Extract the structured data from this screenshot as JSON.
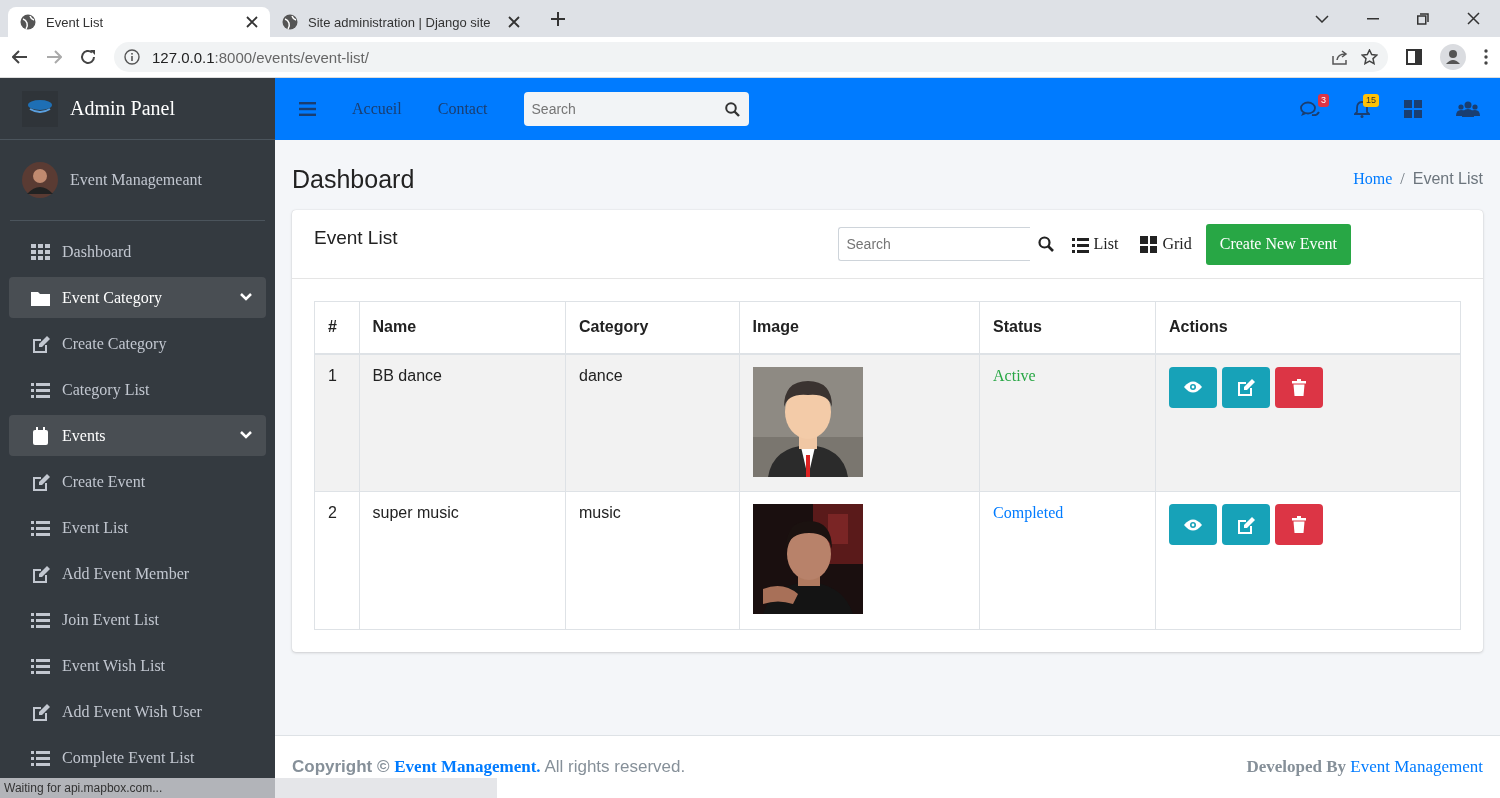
{
  "browser": {
    "tabs": [
      {
        "title": "Event List",
        "selected": true
      },
      {
        "title": "Site administration | Django site",
        "selected": false
      }
    ],
    "address_host": "127.0.0.1",
    "address_path": ":8000/events/event-list/",
    "status_text": "Waiting for api.mapbox.com..."
  },
  "sidebar": {
    "brand": "Admin Panel",
    "user": "Event Managemeant",
    "items": [
      {
        "label": "Dashboard",
        "kind": "link"
      },
      {
        "label": "Event Category",
        "kind": "group",
        "expanded": true
      },
      {
        "label": "Create Category",
        "kind": "link"
      },
      {
        "label": "Category List",
        "kind": "link"
      },
      {
        "label": "Events",
        "kind": "group",
        "expanded": true
      },
      {
        "label": "Create Event",
        "kind": "link"
      },
      {
        "label": "Event List",
        "kind": "link"
      },
      {
        "label": "Add Event Member",
        "kind": "link"
      },
      {
        "label": "Join Event List",
        "kind": "link"
      },
      {
        "label": "Event Wish List",
        "kind": "link"
      },
      {
        "label": "Add Event Wish User",
        "kind": "link"
      },
      {
        "label": "Complete Event List",
        "kind": "link"
      }
    ]
  },
  "navbar": {
    "links": [
      "Accueil",
      "Contact"
    ],
    "search_placeholder": "Search",
    "message_count": "3",
    "notification_count": "15"
  },
  "page": {
    "title": "Dashboard",
    "breadcrumb_separator": "/",
    "breadcrumb": [
      {
        "label": "Home",
        "kind": "link"
      },
      {
        "label": "Event List",
        "kind": "current"
      }
    ]
  },
  "card": {
    "title": "Event List",
    "search_placeholder": "Search",
    "views": [
      "List",
      "Grid"
    ],
    "create_button": "Create New Event",
    "table": {
      "columns": [
        "#",
        "Name",
        "Category",
        "Image",
        "Status",
        "Actions"
      ],
      "rows": [
        {
          "number": "1",
          "name": "BB dance",
          "category": "dance",
          "status": {
            "text": "Active",
            "color": "#28a745"
          }
        },
        {
          "number": "2",
          "name": "super music",
          "category": "music",
          "status": {
            "text": "Completed",
            "color": "#007bff"
          }
        }
      ]
    }
  },
  "footer": {
    "copyright_prefix": "Copyright ©",
    "copyright_link": "Event Management.",
    "copyright_suffix": "All rights reserved.",
    "developed_prefix": "Developed By",
    "developed_link": "Event Management"
  }
}
